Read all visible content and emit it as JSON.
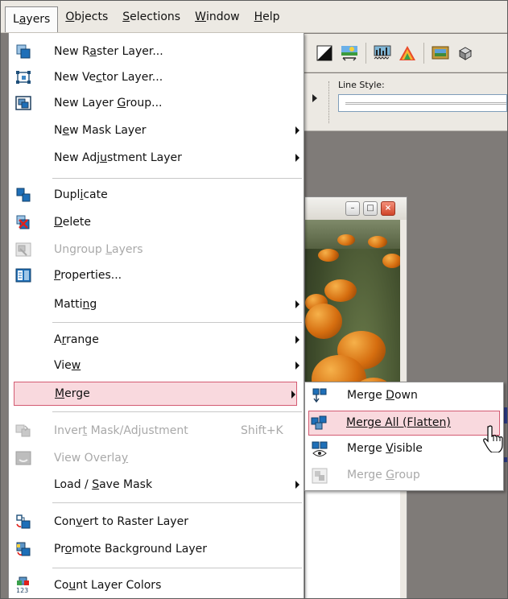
{
  "menubar": {
    "items": [
      {
        "label": "Layers",
        "mnemonic": "a",
        "pre": "L",
        "post": "yers"
      },
      {
        "label": "Objects",
        "pre": "",
        "mnemonic": "O",
        "post": "bjects"
      },
      {
        "label": "Selections",
        "pre": "",
        "mnemonic": "S",
        "post": "elections"
      },
      {
        "label": "Window",
        "pre": "",
        "mnemonic": "W",
        "post": "indow"
      },
      {
        "label": "Help",
        "pre": "",
        "mnemonic": "H",
        "post": "elp"
      }
    ]
  },
  "toolbar": {
    "line_style_label": "Line Style:"
  },
  "layers_menu": {
    "new_raster": {
      "pre": "New R",
      "mn": "a",
      "post": "ster Layer..."
    },
    "new_vector": {
      "pre": "New Ve",
      "mn": "c",
      "post": "tor Layer..."
    },
    "new_group": {
      "pre": "New Layer ",
      "mn": "G",
      "post": "roup..."
    },
    "new_mask": {
      "pre": "N",
      "mn": "e",
      "post": "w Mask Layer"
    },
    "new_adjustment": {
      "pre": "New Adj",
      "mn": "u",
      "post": "stment Layer"
    },
    "duplicate": {
      "pre": "Dupl",
      "mn": "i",
      "post": "cate"
    },
    "delete": {
      "pre": "",
      "mn": "D",
      "post": "elete"
    },
    "ungroup": {
      "pre": "Ungroup ",
      "mn": "L",
      "post": "ayers"
    },
    "properties": {
      "pre": "",
      "mn": "P",
      "post": "roperties..."
    },
    "matting": {
      "pre": "Matti",
      "mn": "n",
      "post": "g"
    },
    "arrange": {
      "pre": "A",
      "mn": "r",
      "post": "range"
    },
    "view": {
      "pre": "Vie",
      "mn": "w",
      "post": ""
    },
    "merge": {
      "pre": "",
      "mn": "M",
      "post": "erge"
    },
    "invert_mask": {
      "pre": "Inver",
      "mn": "t",
      "post": " Mask/Adjustment"
    },
    "invert_mask_shortcut": "Shift+K",
    "view_overlay": {
      "pre": "View Overla",
      "mn": "y",
      "post": ""
    },
    "load_save_mask": {
      "pre": "Load / ",
      "mn": "S",
      "post": "ave Mask"
    },
    "convert_raster": {
      "pre": "Con",
      "mn": "v",
      "post": "ert to Raster Layer"
    },
    "promote_background": {
      "pre": "Pr",
      "mn": "o",
      "post": "mote Background Layer"
    },
    "count_colors": {
      "pre": "Co",
      "mn": "u",
      "post": "nt Layer Colors"
    }
  },
  "merge_submenu": {
    "merge_down": {
      "pre": "Merge ",
      "mn": "D",
      "post": "own"
    },
    "merge_all": {
      "pre": "",
      "mn": "Merge All (Flatten)",
      "post": ""
    },
    "merge_visible": {
      "pre": "Merge ",
      "mn": "V",
      "post": "isible"
    },
    "merge_group": {
      "pre": "Merge ",
      "mn": "G",
      "post": "roup"
    }
  },
  "colors": {
    "highlight_bg": "#f9d9de",
    "highlight_border": "#d35b72",
    "disabled_text": "#a9a9a9",
    "menubar_bg": "#ece9e3"
  },
  "icons": [
    "new-raster-layer-icon",
    "new-vector-layer-icon",
    "new-layer-group-icon",
    "duplicate-icon",
    "delete-icon",
    "ungroup-icon",
    "properties-icon",
    "invert-mask-icon",
    "view-overlay-icon",
    "convert-raster-icon",
    "promote-background-icon",
    "count-colors-icon",
    "merge-down-icon",
    "merge-all-icon",
    "merge-visible-icon",
    "merge-group-icon",
    "hand-cursor-icon"
  ]
}
